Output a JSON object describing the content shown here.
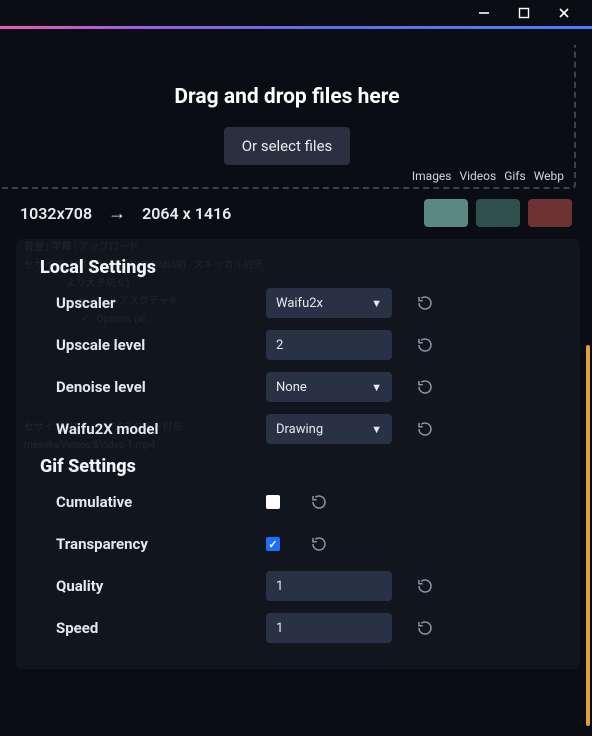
{
  "window": {
    "min": "—",
    "max": "▢",
    "close": "✕"
  },
  "dropzone": {
    "title": "Drag and drop files here",
    "button": "Or select files"
  },
  "formats": [
    "Images",
    "Videos",
    "Gifs",
    "Webp"
  ],
  "dims": {
    "src": "1032x708",
    "dst": "2064 x 1416"
  },
  "local": {
    "title": "Local Settings",
    "upscaler_label": "Upscaler",
    "upscaler_value": "Waifu2x",
    "upscale_level_label": "Upscale level",
    "upscale_level_value": "2",
    "denoise_label": "Denoise level",
    "denoise_value": "None",
    "model_label": "Waifu2X model",
    "model_value": "Drawing"
  },
  "gif": {
    "title": "Gif Settings",
    "cumulative_label": "Cumulative",
    "cumulative_checked": false,
    "transparency_label": "Transparency",
    "transparency_checked": true,
    "quality_label": "Quality",
    "quality_value": "1",
    "speed_label": "Speed",
    "speed_value": "1"
  }
}
